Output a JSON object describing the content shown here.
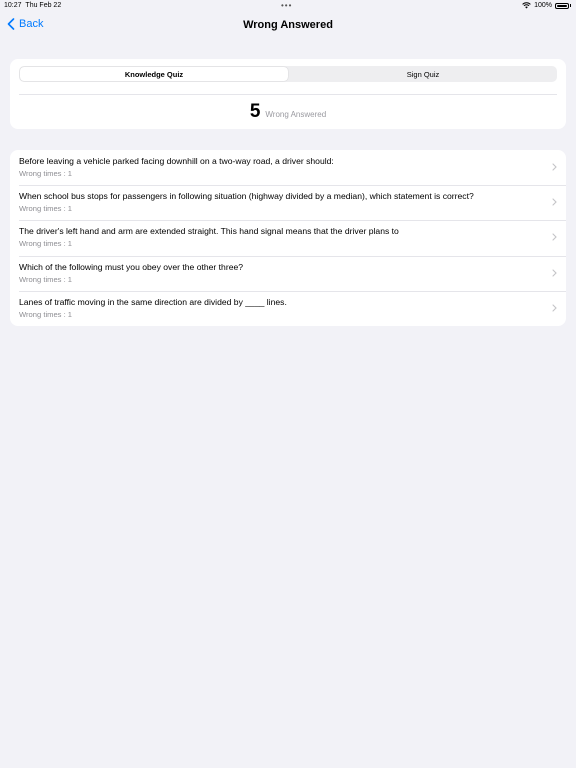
{
  "status_bar": {
    "time": "10:27",
    "date": "Thu Feb 22",
    "battery": "100%"
  },
  "nav": {
    "back_label": "Back",
    "title": "Wrong Answered"
  },
  "segments": [
    "Knowledge Quiz",
    "Sign Quiz"
  ],
  "selected_segment": "Knowledge Quiz",
  "summary": {
    "count": "5",
    "label": "Wrong Answered"
  },
  "questions": [
    {
      "text": "Before leaving a vehicle parked facing downhill on a two-way road, a driver should:",
      "wrong_times": "Wrong times : 1"
    },
    {
      "text": "When school bus stops for passengers in following situation (highway divided by a median), which statement is correct?",
      "wrong_times": "Wrong times : 1"
    },
    {
      "text": "The driver's left hand and arm are extended straight. This hand signal means that the driver plans to",
      "wrong_times": "Wrong times : 1"
    },
    {
      "text": "Which of the following must you obey over the other three?",
      "wrong_times": "Wrong times : 1"
    },
    {
      "text": "Lanes of traffic moving in the same direction are divided by ____ lines.",
      "wrong_times": "Wrong times : 1"
    }
  ],
  "colors": {
    "accent": "#007aff",
    "background": "#f2f2f7",
    "secondary_text": "#8e8e93"
  }
}
